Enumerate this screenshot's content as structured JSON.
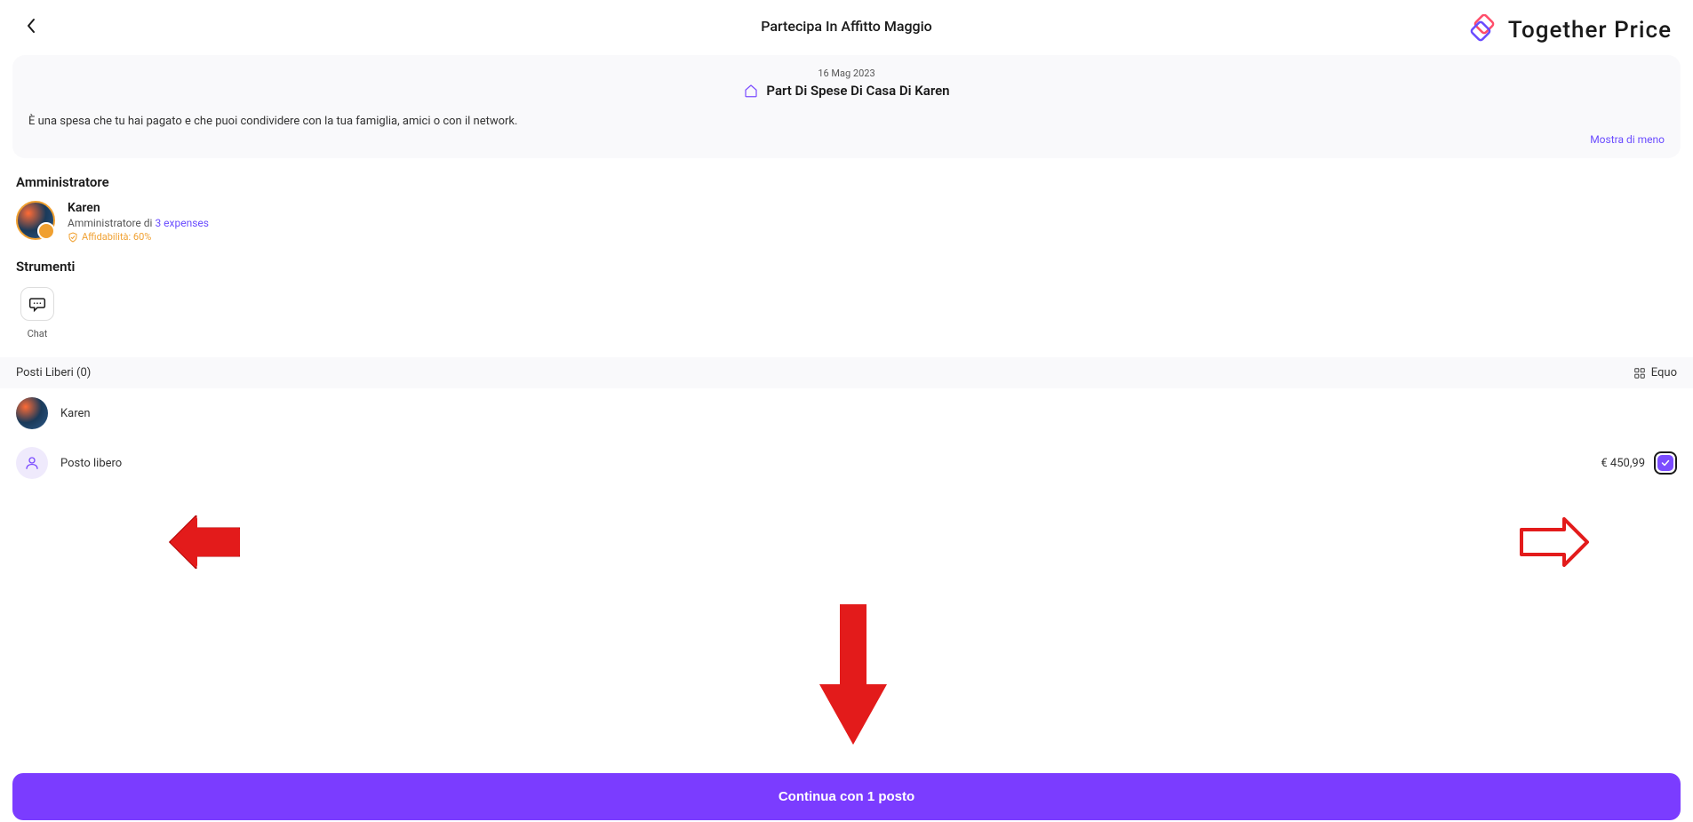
{
  "header": {
    "title": "Partecipa In Affitto Maggio",
    "logo_text": "Together Price"
  },
  "info": {
    "date": "16 Mag 2023",
    "title": "Part Di Spese Di Casa Di Karen",
    "description": "È una spesa che tu hai pagato e che puoi condividere con la tua famiglia, amici o con il network.",
    "less_label": "Mostra di meno"
  },
  "admin": {
    "section_label": "Amministratore",
    "name": "Karen",
    "sub_prefix": "Amministratore di ",
    "sub_link": "3 expenses",
    "badge": "Affidabilità: 60%"
  },
  "tools": {
    "section_label": "Strumenti",
    "chat_label": "Chat"
  },
  "slots": {
    "header_label": "Posti Liberi (0)",
    "mode_label": "Equo",
    "rows": [
      {
        "name": "Karen"
      },
      {
        "name": "Posto libero",
        "price": "€ 450,99"
      }
    ]
  },
  "continue": {
    "label": "Continua con 1 posto"
  },
  "colors": {
    "accent": "#7b3cff",
    "link": "#6a4cff",
    "gold": "#f0a030"
  }
}
